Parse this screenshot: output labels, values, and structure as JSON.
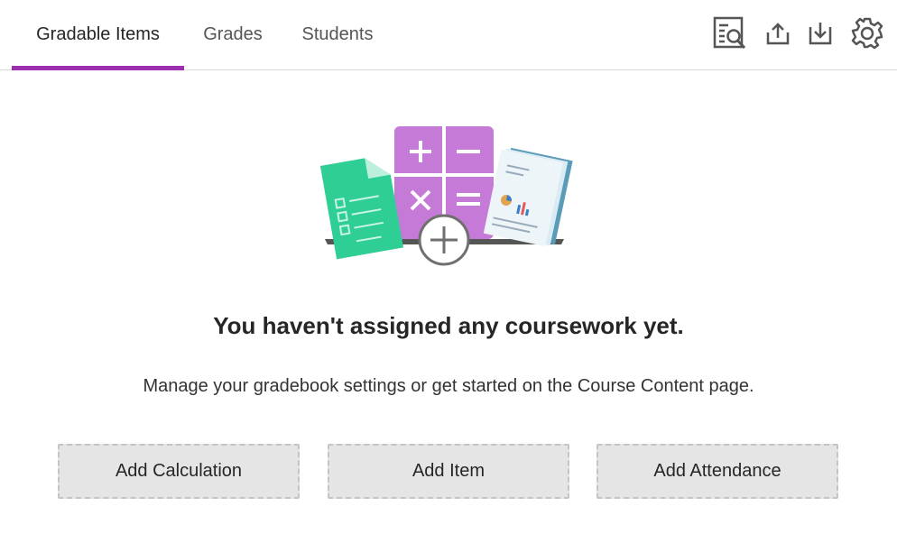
{
  "tabs": [
    {
      "label": "Gradable Items",
      "active": true
    },
    {
      "label": "Grades",
      "active": false
    },
    {
      "label": "Students",
      "active": false
    }
  ],
  "toolbar": {
    "icons": [
      "search-report-icon",
      "upload-icon",
      "download-icon",
      "gear-icon"
    ]
  },
  "empty_state": {
    "title": "You haven't assigned any coursework yet.",
    "description": "Manage your gradebook settings or get started on the Course Content page."
  },
  "actions": {
    "add_calculation": "Add Calculation",
    "add_item": "Add Item",
    "add_attendance": "Add Attendance"
  },
  "colors": {
    "accent": "#9b2fae",
    "calculator": "#c47ad6",
    "sheet_green": "#2fce94",
    "doc_blue": "#5a9bb8"
  }
}
